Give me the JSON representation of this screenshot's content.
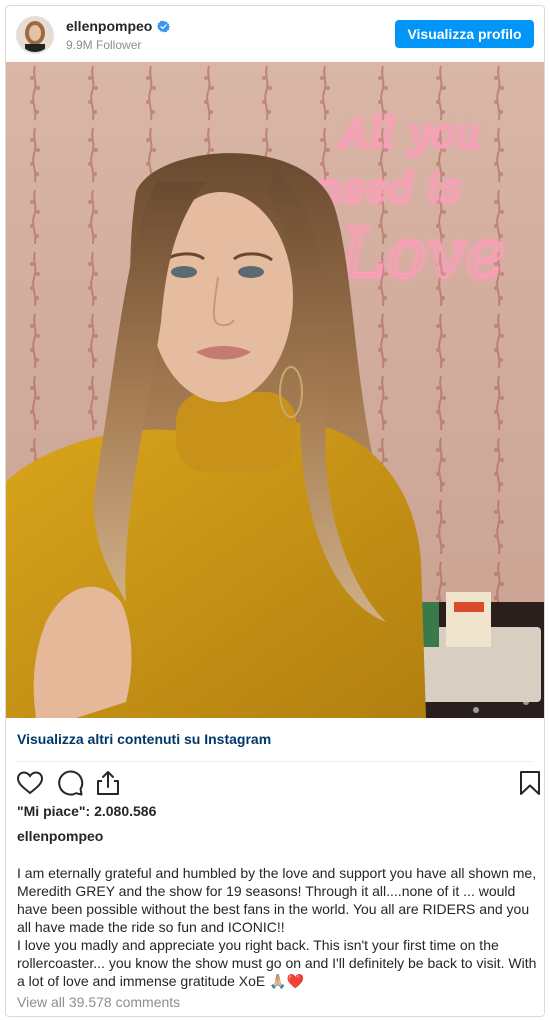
{
  "post": {
    "username": "ellenpompeo",
    "followers": "9.9M Follower",
    "profile_button": "Visualizza profilo",
    "photo_neon_text": "All you need is Love",
    "more_link": "Visualizza altri contenuti su Instagram",
    "likes": "\"Mi piace\": 2.080.586",
    "caption_username": "ellenpompeo",
    "caption_lines": [
      "I am eternally grateful and humbled by the love and support you have all shown me, Meredith GREY and the show for 19 seasons! Through it all....none of it ... would have been possible without the best fans in the world. You all are RIDERS and you all have made the ride so fun and ICONIC!!",
      "I love you madly and appreciate you right back. This isn't your first time on the rollercoaster... you know the show must go on and I'll definitely be back to visit. With a lot of love and immense gratitude XoE 🙏🏼❤️"
    ],
    "comments_link": "View all 39.578 comments"
  },
  "icons": {
    "verified": "verified-badge-icon",
    "like": "heart-icon",
    "comment": "comment-icon",
    "share": "share-icon",
    "save": "bookmark-icon"
  },
  "colors": {
    "accent": "#0095f6",
    "link": "#00376b",
    "muted": "#8e8e8e",
    "neon": "#ff8fb0"
  }
}
